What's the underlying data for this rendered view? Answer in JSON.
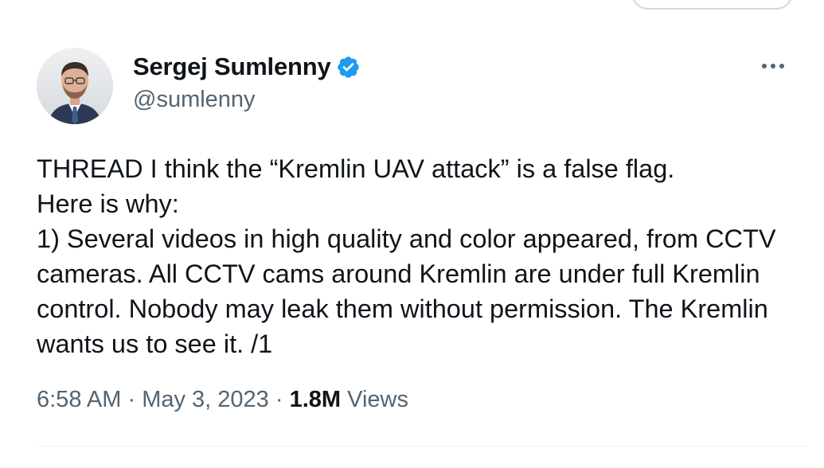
{
  "author": {
    "display_name": "Sergej Sumlenny",
    "handle": "@sumlenny",
    "verified": true,
    "avatar_icon": "profile-photo",
    "verified_icon": "verified-badge-icon"
  },
  "tweet": {
    "text": "THREAD I think the “Kremlin UAV attack” is a false flag.\nHere is why:\n1) Several videos in high quality and color appeared, from CCTV cameras. All CCTV cams around Kremlin are under full Kremlin control. Nobody may leak them without permission. The Kremlin wants us to see it. /1"
  },
  "meta": {
    "time": "6:58 AM",
    "separator": "·",
    "date": "May 3, 2023",
    "views_count": "1.8M",
    "views_label": "Views"
  },
  "colors": {
    "primary_text": "#0f1419",
    "secondary_text": "#536471",
    "verified_blue": "#1d9bf0",
    "border": "#cfd9de"
  },
  "icons": {
    "more": "more-horizontal-icon"
  }
}
